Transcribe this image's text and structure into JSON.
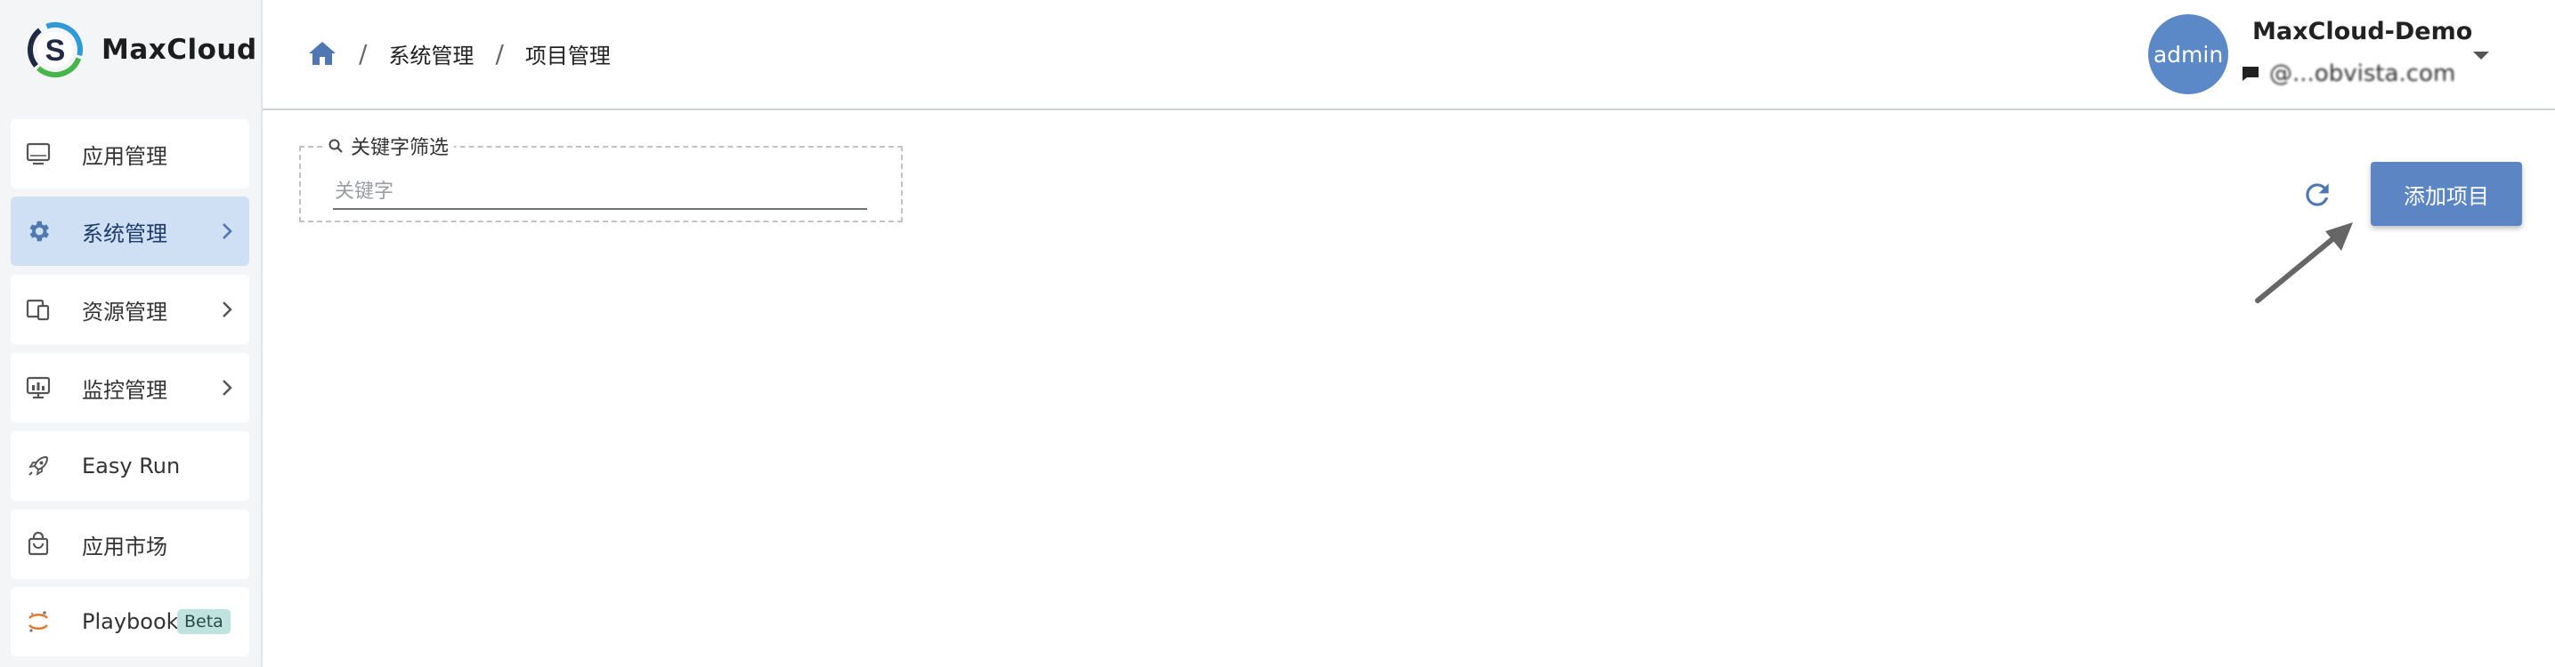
{
  "brand": {
    "name": "MaxCloud",
    "logo_letter": "S"
  },
  "sidebar": {
    "items": [
      {
        "label": "应用管理",
        "icon": "monitor-icon",
        "chevron": false,
        "active": false
      },
      {
        "label": "系统管理",
        "icon": "gear-icon",
        "chevron": true,
        "active": true
      },
      {
        "label": "资源管理",
        "icon": "devices-icon",
        "chevron": true,
        "active": false
      },
      {
        "label": "监控管理",
        "icon": "monitor-chart-icon",
        "chevron": true,
        "active": false
      },
      {
        "label": "Easy Run",
        "icon": "rocket-icon",
        "chevron": false,
        "active": false
      },
      {
        "label": "应用市场",
        "icon": "shopping-bag-icon",
        "chevron": false,
        "active": false
      },
      {
        "label": "Playbook",
        "icon": "jupyter-icon",
        "chevron": false,
        "active": false,
        "badge": "Beta"
      }
    ]
  },
  "header": {
    "breadcrumb": [
      "系统管理",
      "项目管理"
    ],
    "user": {
      "avatar_text": "admin",
      "name": "MaxCloud-Demo",
      "email": "@...obvista.com"
    }
  },
  "filter": {
    "legend": "关键字筛选",
    "placeholder": "关键字",
    "value": ""
  },
  "actions": {
    "add_label": "添加项目"
  },
  "colors": {
    "accent": "#5b86c3",
    "active_nav_bg": "#cfe0f5",
    "sidebar_bg": "#f4f5f7",
    "beta_bg": "#bfe3de"
  }
}
